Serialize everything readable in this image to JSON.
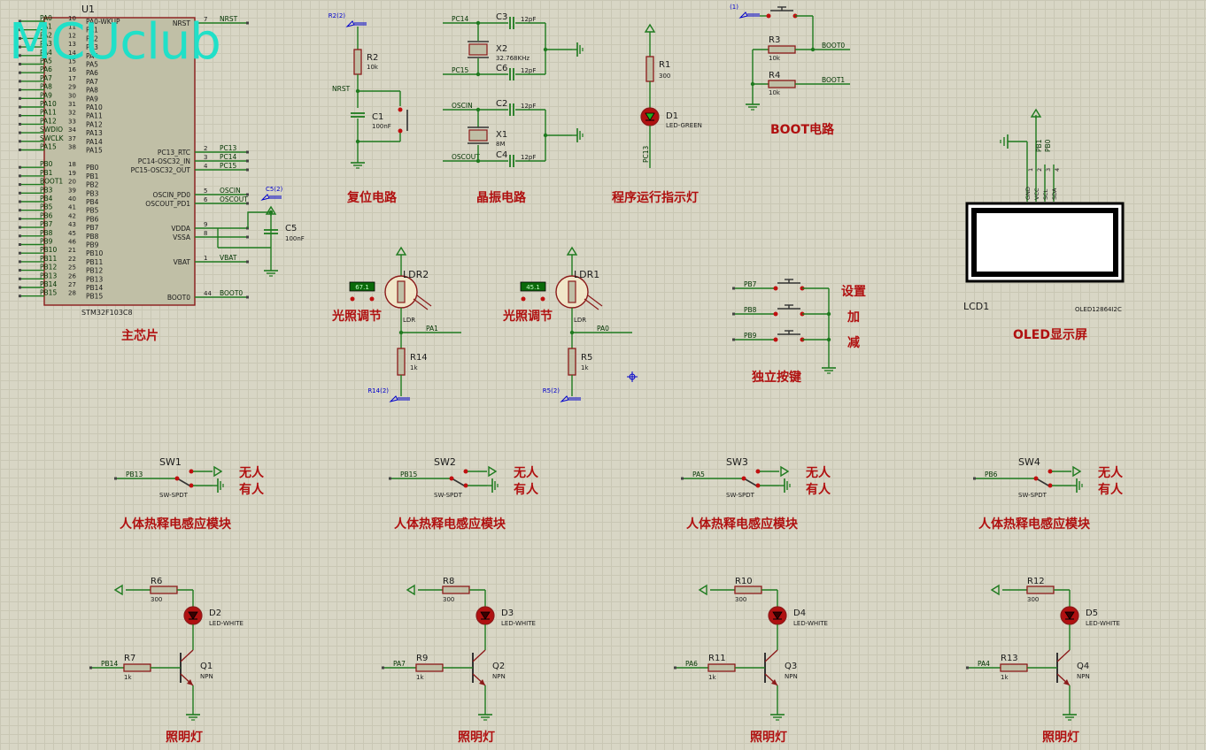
{
  "watermark": "MCUclub",
  "colors": {
    "wire": "#1e7a1e",
    "body": "#c0bfa6",
    "outline": "#8b1a1a",
    "label": "#8b1a1a",
    "pinnum": "#1a1a1a",
    "net": "#003300",
    "title": "#b01010",
    "prop": "#1a1a1a",
    "probe": "#0000cc",
    "led_green": "#1fb01f",
    "led_white": "#3a0000"
  },
  "mcu": {
    "ref": "U1",
    "part": "STM32F103C8",
    "title": "主芯片",
    "left_pins": [
      {
        "net": "PA0",
        "num": "10",
        "name": "PA0-WKUP"
      },
      {
        "net": "PA1",
        "num": "11",
        "name": "PA1"
      },
      {
        "net": "PA2",
        "num": "12",
        "name": "PA2"
      },
      {
        "net": "PA3",
        "num": "13",
        "name": "PA3"
      },
      {
        "net": "PA4",
        "num": "14",
        "name": "PA4"
      },
      {
        "net": "PA5",
        "num": "15",
        "name": "PA5"
      },
      {
        "net": "PA6",
        "num": "16",
        "name": "PA6"
      },
      {
        "net": "PA7",
        "num": "17",
        "name": "PA7"
      },
      {
        "net": "PA8",
        "num": "29",
        "name": "PA8"
      },
      {
        "net": "PA9",
        "num": "30",
        "name": "PA9"
      },
      {
        "net": "PA10",
        "num": "31",
        "name": "PA10"
      },
      {
        "net": "PA11",
        "num": "32",
        "name": "PA11"
      },
      {
        "net": "PA12",
        "num": "33",
        "name": "PA12"
      },
      {
        "net": "SWDIO",
        "num": "34",
        "name": "PA13"
      },
      {
        "net": "SWCLK",
        "num": "37",
        "name": "PA14"
      },
      {
        "net": "PA15",
        "num": "38",
        "name": "PA15"
      },
      {
        "net": "PB0",
        "num": "18",
        "name": "PB0"
      },
      {
        "net": "PB1",
        "num": "19",
        "name": "PB1"
      },
      {
        "net": "BOOT1",
        "num": "20",
        "name": "PB2"
      },
      {
        "net": "PB3",
        "num": "39",
        "name": "PB3"
      },
      {
        "net": "PB4",
        "num": "40",
        "name": "PB4"
      },
      {
        "net": "PB5",
        "num": "41",
        "name": "PB5"
      },
      {
        "net": "PB6",
        "num": "42",
        "name": "PB6"
      },
      {
        "net": "PB7",
        "num": "43",
        "name": "PB7"
      },
      {
        "net": "PB8",
        "num": "45",
        "name": "PB8"
      },
      {
        "net": "PB9",
        "num": "46",
        "name": "PB9"
      },
      {
        "net": "PB10",
        "num": "21",
        "name": "PB10"
      },
      {
        "net": "PB11",
        "num": "22",
        "name": "PB11"
      },
      {
        "net": "PB12",
        "num": "25",
        "name": "PB12"
      },
      {
        "net": "PB13",
        "num": "26",
        "name": "PB13"
      },
      {
        "net": "PB14",
        "num": "27",
        "name": "PB14"
      },
      {
        "net": "PB15",
        "num": "28",
        "name": "PB15"
      }
    ],
    "right_pins": [
      {
        "net": "NRST",
        "num": "7",
        "name": "NRST"
      },
      {
        "net": "PC13",
        "num": "2",
        "name": "PC13_RTC"
      },
      {
        "net": "PC14",
        "num": "3",
        "name": "PC14-OSC32_IN"
      },
      {
        "net": "PC15",
        "num": "4",
        "name": "PC15-OSC32_OUT"
      },
      {
        "net": "OSCIN",
        "num": "5",
        "name": "OSCIN_PD0"
      },
      {
        "net": "OSCOUT",
        "num": "6",
        "name": "OSCOUT_PD1"
      },
      {
        "net": "",
        "num": "9",
        "name": "VDDA"
      },
      {
        "net": "",
        "num": "8",
        "name": "VSSA"
      },
      {
        "net": "VBAT",
        "num": "1",
        "name": "VBAT"
      },
      {
        "net": "BOOT0",
        "num": "44",
        "name": "BOOT0"
      }
    ],
    "c5": {
      "ref": "C5",
      "val": "100nF",
      "probe": "C5(2)"
    }
  },
  "reset": {
    "title": "复位电路",
    "r": "R2",
    "rv": "10k",
    "c": "C1",
    "cv": "100nF",
    "net": "NRST",
    "probe": "R2(2)"
  },
  "crystal": {
    "title": "晶振电路",
    "c3": "C3",
    "c4": "C4",
    "c6": "C6",
    "c2": "C2",
    "cv": "12pF",
    "x2": "X2",
    "x2v": "32.768KHz",
    "x1": "X1",
    "x1v": "8M",
    "n1": "PC14",
    "n2": "PC15",
    "n3": "OSCIN",
    "n4": "OSCOUT"
  },
  "runled": {
    "title": "程序运行指示灯",
    "r": "R1",
    "rv": "300",
    "d": "D1",
    "dv": "LED-GREEN",
    "net": "PC13"
  },
  "boot": {
    "title": "BOOT电路",
    "r3": "R3",
    "r4": "R4",
    "rv": "10k",
    "n0": "BOOT0",
    "n1": "BOOT1",
    "probe": "(1)"
  },
  "oled": {
    "title": "OLED显示屏",
    "ref": "LCD1",
    "part": "OLED12864I2C",
    "pins": [
      "GND",
      "VCC",
      "SCL",
      "SDA"
    ],
    "nums": [
      "1",
      "2",
      "3",
      "4"
    ],
    "nets": [
      "PB1",
      "PB0"
    ]
  },
  "ldrs": [
    {
      "title": "光照调节",
      "ref": "LDR2",
      "val": "LDR",
      "meter": "67.1",
      "r": "R14",
      "rv": "1k",
      "net": "PA1",
      "probe": "R14(2)"
    },
    {
      "title": "光照调节",
      "ref": "LDR1",
      "val": "LDR",
      "meter": "45.1",
      "r": "R5",
      "rv": "1k",
      "net": "PA0",
      "probe": "R5(2)"
    }
  ],
  "keys": {
    "title": "独立按键",
    "nets": [
      "PB7",
      "PB8",
      "PB9"
    ],
    "labels": [
      "设置",
      "加",
      "减"
    ]
  },
  "pirs": [
    {
      "ref": "SW1",
      "net": "PB13"
    },
    {
      "ref": "SW2",
      "net": "PB15"
    },
    {
      "ref": "SW3",
      "net": "PA5"
    },
    {
      "ref": "SW4",
      "net": "PB6"
    }
  ],
  "pir_common": {
    "part": "SW-SPDT",
    "none": "无人",
    "some": "有人",
    "title": "人体热释电感应模块"
  },
  "lights": [
    {
      "r1": "R6",
      "d": "D2",
      "r2": "R7",
      "q": "Q1",
      "net": "PB14"
    },
    {
      "r1": "R8",
      "d": "D3",
      "r2": "R9",
      "q": "Q2",
      "net": "PA7"
    },
    {
      "r1": "R10",
      "d": "D4",
      "r2": "R11",
      "q": "Q3",
      "net": "PA6"
    },
    {
      "r1": "R12",
      "d": "D5",
      "r2": "R13",
      "q": "Q4",
      "net": "PA4"
    }
  ],
  "light_common": {
    "r1v": "300",
    "r2v": "1k",
    "dv": "LED-WHITE",
    "qv": "NPN",
    "title": "照明灯"
  }
}
